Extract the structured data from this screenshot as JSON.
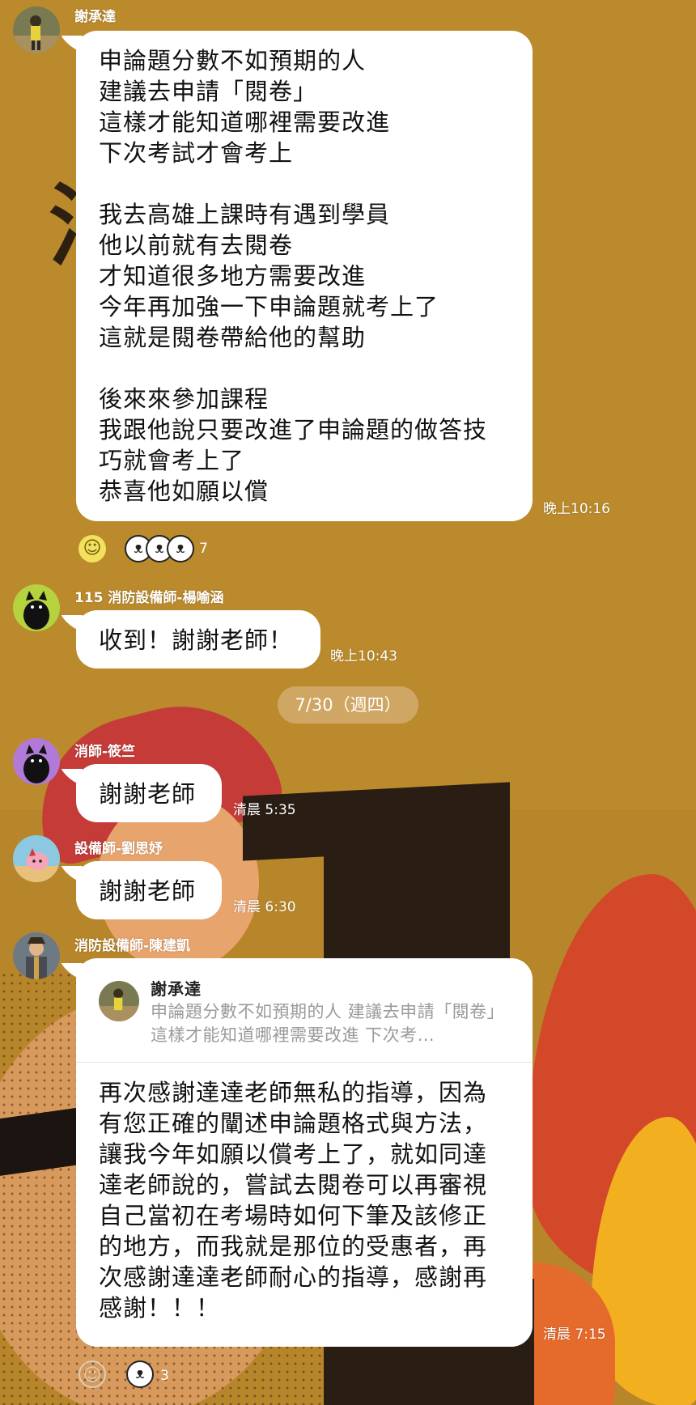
{
  "messages": [
    {
      "sender": "謝承達",
      "text": "申論題分數不如預期的人\n建議去申請「閱卷」\n這樣才能知道哪裡需要改進\n下次考試才會考上\n\n我去高雄上課時有遇到學員\n他以前就有去閱卷\n才知道很多地方需要改進\n今年再加強一下申論題就考上了\n這就是閱卷帶給他的幫助\n\n後來來參加課程\n我跟他說只要改進了申論題的做答技\n巧就會考上了\n恭喜他如願以償",
      "time": "晚上10:16",
      "reaction_count": "7"
    },
    {
      "sender": "115 消防設備師-楊喻涵",
      "text": "收到！謝謝老師！",
      "time": "晚上10:43"
    },
    {
      "sender": "消師-筱竺",
      "text": "謝謝老師",
      "time": "清晨 5:35"
    },
    {
      "sender": "設備師-劉思妤",
      "text": "謝謝老師",
      "time": "清晨 6:30"
    },
    {
      "sender": "消防設備師-陳建凱",
      "reply_to_name": "謝承達",
      "reply_snippet": "申論題分數不如預期的人 建議去申請「閱卷」這樣才能知道哪裡需要改進 下次考…",
      "text": "再次感謝達達老師無私的指導，因為\n有您正確的闡述申論題格式與方法，\n讓我今年如願以償考上了，就如同達\n達老師說的，嘗試去閱卷可以再審視\n自己當初在考場時如何下筆及該修正\n的地方，而我就是那位的受惠者，再\n次感謝達達老師耐心的指導，感謝再\n感謝！！！",
      "time": "清晨 7:15",
      "reaction_count": "3"
    }
  ],
  "date_separator": "7/30（週四）",
  "background_text": "消　區",
  "icons": {
    "add_reaction": "smile-icon",
    "reaction_stickers": "panda-face-icon"
  },
  "colors": {
    "background": "#b8862a",
    "bubble": "#ffffff",
    "reaction_yellow": "#f3e05c"
  }
}
